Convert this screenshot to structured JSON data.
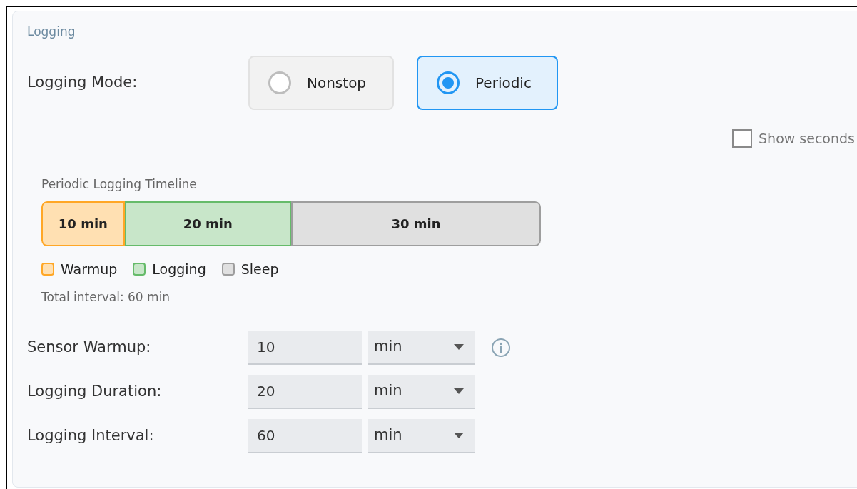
{
  "section": {
    "title": "Logging"
  },
  "mode": {
    "label": "Logging Mode:",
    "options": [
      {
        "label": "Nonstop",
        "selected": false
      },
      {
        "label": "Periodic",
        "selected": true
      }
    ]
  },
  "show_seconds": {
    "label": "Show seconds",
    "checked": false
  },
  "timeline": {
    "title": "Periodic Logging Timeline",
    "segments": [
      {
        "kind": "warmup",
        "label": "10 min",
        "level": 0.1667,
        "color": "#ffe0b2"
      },
      {
        "kind": "logging",
        "label": "20 min",
        "level": 0.3333,
        "color": "#c8e6c9"
      },
      {
        "kind": "sleep",
        "label": "30 min",
        "level": 0.5,
        "color": "#e0e0e0"
      }
    ],
    "legend": [
      {
        "kind": "warmup",
        "label": "Warmup",
        "color": "#ffe0b2"
      },
      {
        "kind": "logging",
        "label": "Logging",
        "color": "#c8e6c9"
      },
      {
        "kind": "sleep",
        "label": "Sleep",
        "color": "#e0e0e0"
      }
    ],
    "total": "Total interval: 60 min"
  },
  "fields": [
    {
      "label": "Sensor Warmup:",
      "value": "10",
      "unit": "min",
      "info": true
    },
    {
      "label": "Logging Duration:",
      "value": "20",
      "unit": "min",
      "info": false
    },
    {
      "label": "Logging Interval:",
      "value": "60",
      "unit": "min",
      "info": false
    }
  ]
}
